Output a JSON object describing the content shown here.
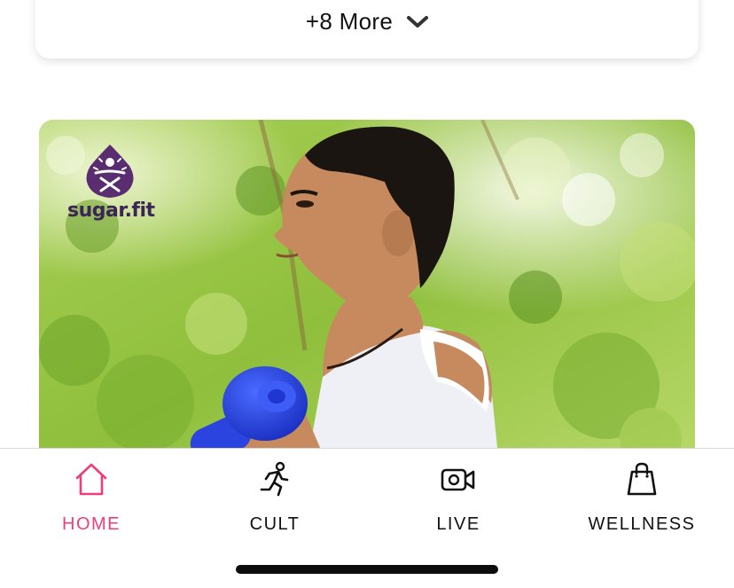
{
  "more_card": {
    "label": "+8 More",
    "icon": "chevron-down-icon"
  },
  "promo": {
    "brand_name": "sugar.fit",
    "logo_icon": "sugar-fit-logo",
    "image_subject": "man-lifting-dumbbell-outdoors"
  },
  "bottom_nav": {
    "active_color": "#ec3f78",
    "items": [
      {
        "label": "HOME",
        "icon": "home-icon",
        "active": true
      },
      {
        "label": "CULT",
        "icon": "running-person-icon",
        "active": false
      },
      {
        "label": "LIVE",
        "icon": "video-camera-icon",
        "active": false
      },
      {
        "label": "WELLNESS",
        "icon": "shopping-bag-icon",
        "active": false
      }
    ]
  }
}
